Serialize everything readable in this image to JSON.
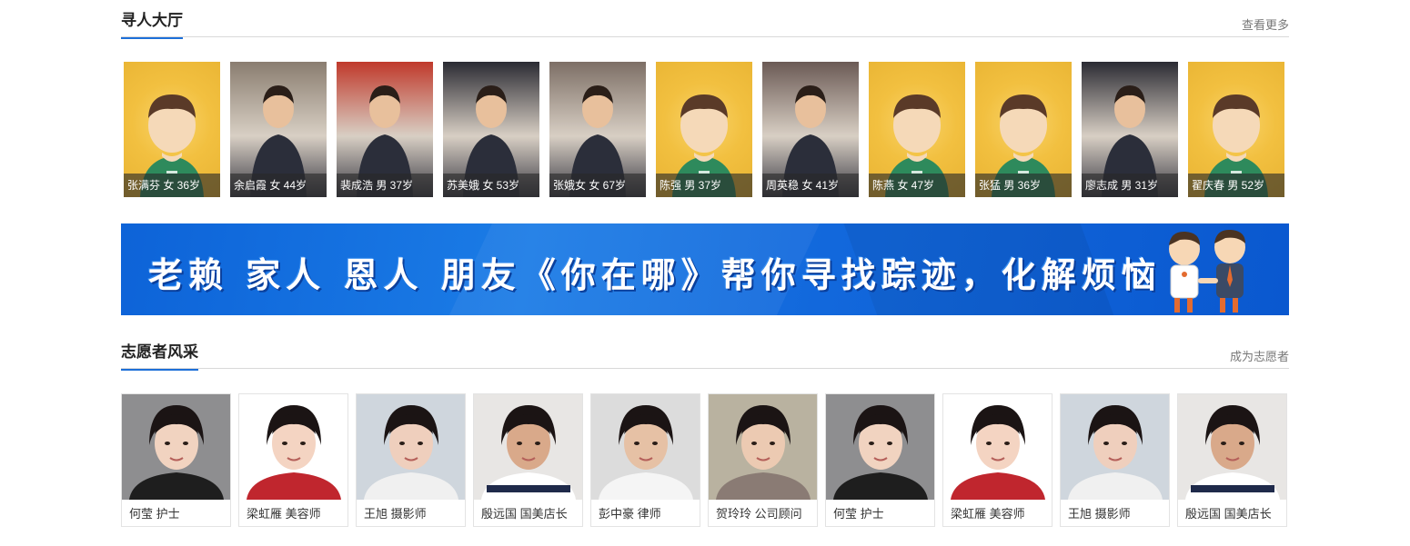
{
  "seek": {
    "title": "寻人大厅",
    "more": "查看更多",
    "people": [
      {
        "caption": "张满芬 女 36岁",
        "photo": "default-avatar"
      },
      {
        "caption": "余启霞 女 44岁",
        "photo": "photo"
      },
      {
        "caption": "裴成浩 男 37岁",
        "photo": "photo"
      },
      {
        "caption": "苏美娥 女 53岁",
        "photo": "photo"
      },
      {
        "caption": "张娥女 女 67岁",
        "photo": "photo"
      },
      {
        "caption": "陈强 男 37岁",
        "photo": "default-avatar"
      },
      {
        "caption": "周英稳 女 41岁",
        "photo": "photo"
      },
      {
        "caption": "陈燕 女 47岁",
        "photo": "default-avatar"
      },
      {
        "caption": "张猛 男 36岁",
        "photo": "default-avatar"
      },
      {
        "caption": "廖志成 男 31岁",
        "photo": "photo"
      },
      {
        "caption": "翟庆春 男 52岁",
        "photo": "default-avatar"
      }
    ]
  },
  "banner": {
    "text": "老赖 家人 恩人 朋友《你在哪》帮你寻找踪迹，化解烦恼"
  },
  "volunteers": {
    "title": "志愿者风采",
    "more": "成为志愿者",
    "items": [
      {
        "caption": "何莹 护士"
      },
      {
        "caption": "梁虹雁 美容师"
      },
      {
        "caption": "王旭 摄影师"
      },
      {
        "caption": "殷远国 国美店长"
      },
      {
        "caption": "彭中豪 律师"
      },
      {
        "caption": "贺玲玲 公司顾问"
      },
      {
        "caption": "何莹 护士"
      },
      {
        "caption": "梁虹雁 美容师"
      },
      {
        "caption": "王旭 摄影师"
      },
      {
        "caption": "殷远国 国美店长"
      }
    ]
  },
  "colors": {
    "accent": "#1d6fd8",
    "avatar_bg": "#f2c040",
    "banner": "#0d63d8"
  }
}
